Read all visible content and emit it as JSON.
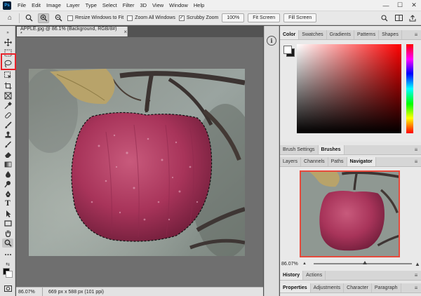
{
  "menubar": {
    "logo": "Ps",
    "items": [
      "File",
      "Edit",
      "Image",
      "Layer",
      "Type",
      "Select",
      "Filter",
      "3D",
      "View",
      "Window",
      "Help"
    ],
    "window_controls": [
      "—",
      "☐",
      "✕"
    ]
  },
  "options": {
    "resize_windows": "Resize Windows to Fit",
    "zoom_all": "Zoom All Windows",
    "scrubby_zoom": "Scrubby Zoom",
    "zoom_value": "100%",
    "fit_screen": "Fit Screen",
    "fill_screen": "Fill Screen"
  },
  "document": {
    "tab_title": "APPLE.jpg @ 86.1% (Background, RGB/8#) *",
    "close": "×"
  },
  "status": {
    "zoom": "86.07%",
    "dimensions": "669 px x 588 px (101 ppi)"
  },
  "panels": {
    "color_tabs": [
      "Color",
      "Swatches",
      "Gradients",
      "Patterns",
      "Shapes"
    ],
    "brush_tabs": [
      "Brush Settings",
      "Brushes"
    ],
    "nav_tabs": [
      "Layers",
      "Channels",
      "Paths",
      "Navigator"
    ],
    "nav_zoom": "86.07%",
    "history_tabs": [
      "History",
      "Actions"
    ],
    "props_tabs": [
      "Properties",
      "Adjustments",
      "Character",
      "Paragraph"
    ]
  },
  "icons": {
    "home": "⌂",
    "zoom": "🔍",
    "info": "i",
    "menu": "≡"
  }
}
